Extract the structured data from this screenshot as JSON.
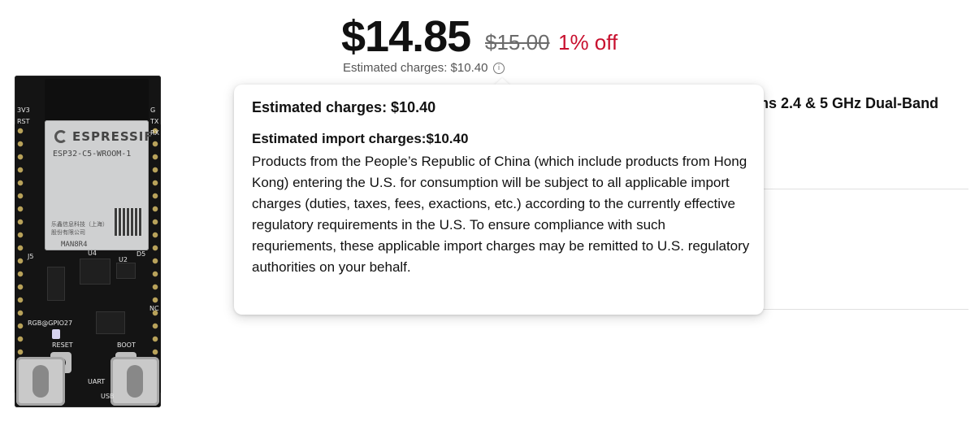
{
  "product_image": {
    "brand": "ESPRESSIF",
    "module_model": "ESP32-C5-WROOM-1",
    "module_maker": "乐鑫信息科技（上海）股份有限公司",
    "module_code": "MAN8R4",
    "labels": [
      "RESET",
      "BOOT",
      "UART",
      "USB",
      "RGB@GPIO27",
      "J5",
      "U4",
      "U2",
      "D5",
      "3V3",
      "RST",
      "TX",
      "RX",
      "G",
      "NC"
    ]
  },
  "price": {
    "current": "$14.85",
    "original": "$15.00",
    "discount": "1% off",
    "estimated_charges": "Estimated charges: $10.40",
    "info_icon": "info-icon",
    "discount_color": "#c8102e"
  },
  "product": {
    "title_fragment": "ms 2.4 & 5 GHz Dual-Band"
  },
  "tooltip": {
    "title": "Estimated charges: $10.40",
    "subtitle": "Estimated import charges:$10.40",
    "body": "Products from the People’s Republic of China (which include products from Hong Kong) entering the U.S. for consumption will be subject to all applicable import charges (duties, taxes, fees, exactions, etc.) according to the currently effective regulatory requirements in the U.S. To ensure compliance with such requriements, these applicable import charges may be remitted to U.S. regulatory authorities on your behalf."
  }
}
